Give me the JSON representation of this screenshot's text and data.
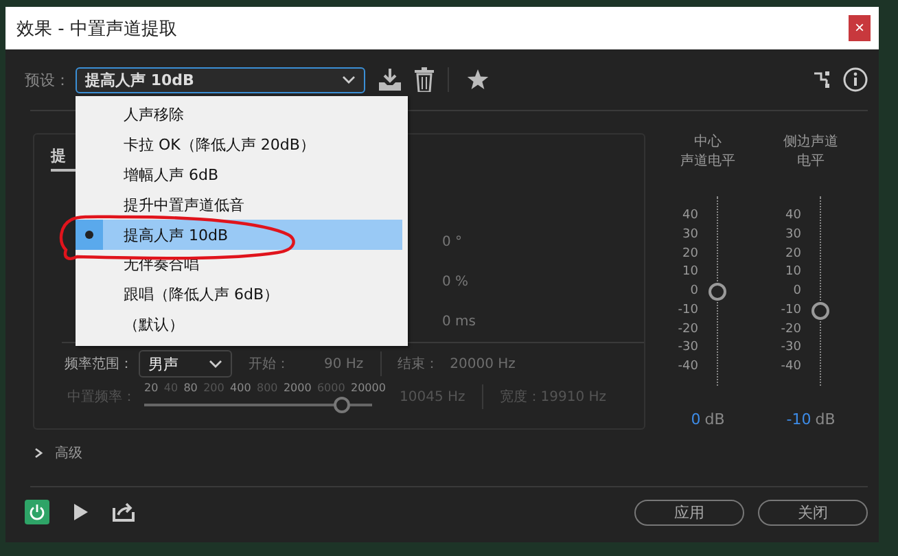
{
  "window": {
    "title": "效果 - 中置声道提取",
    "close": "×"
  },
  "preset": {
    "label": "预设：",
    "value": "提高人声 10dB"
  },
  "preset_menu": [
    {
      "label": "人声移除",
      "selected": false
    },
    {
      "label": "卡拉 OK（降低人声 20dB）",
      "selected": false
    },
    {
      "label": "增幅人声 6dB",
      "selected": false
    },
    {
      "label": "提升中置声道低音",
      "selected": false
    },
    {
      "label": "提高人声 10dB",
      "selected": true
    },
    {
      "label": "无伴奏合唱",
      "selected": false
    },
    {
      "label": "跟唱（降低人声 6dB）",
      "selected": false
    },
    {
      "label": "（默认）",
      "selected": false
    }
  ],
  "panel": {
    "tab": "提",
    "values": [
      "0 °",
      "0 %",
      "0 ms"
    ],
    "frequency_range": {
      "label": "频率范围：",
      "value": "男声",
      "start_label": "开始：",
      "start": "90 Hz",
      "end_label": "结束：",
      "end": "20000 Hz"
    },
    "center_frequency": {
      "label": "中置频率：",
      "scale": [
        "20",
        "40",
        "80",
        "200",
        "400",
        "800",
        "2000",
        "6000",
        "20000"
      ],
      "level": 0.87,
      "reading": "10045 Hz",
      "width": "宽度：19910 Hz"
    }
  },
  "meters": [
    {
      "label_lines": [
        "中心",
        "声道电平"
      ],
      "ticks": [
        "40",
        "30",
        "20",
        "10",
        "0",
        "-10",
        "-20",
        "-30",
        "-40"
      ],
      "level": 0.5,
      "value": "0",
      "unit": "dB"
    },
    {
      "label_lines": [
        "侧边声道",
        "电平"
      ],
      "ticks": [
        "40",
        "30",
        "20",
        "10",
        "0",
        "-10",
        "-20",
        "-30",
        "-40"
      ],
      "level": 0.4,
      "value": "-10",
      "unit": "dB"
    }
  ],
  "advanced": {
    "label": "高级",
    "expanded": false
  },
  "footer": {
    "power_on": true,
    "buttons": [
      "应用",
      "关闭"
    ]
  }
}
